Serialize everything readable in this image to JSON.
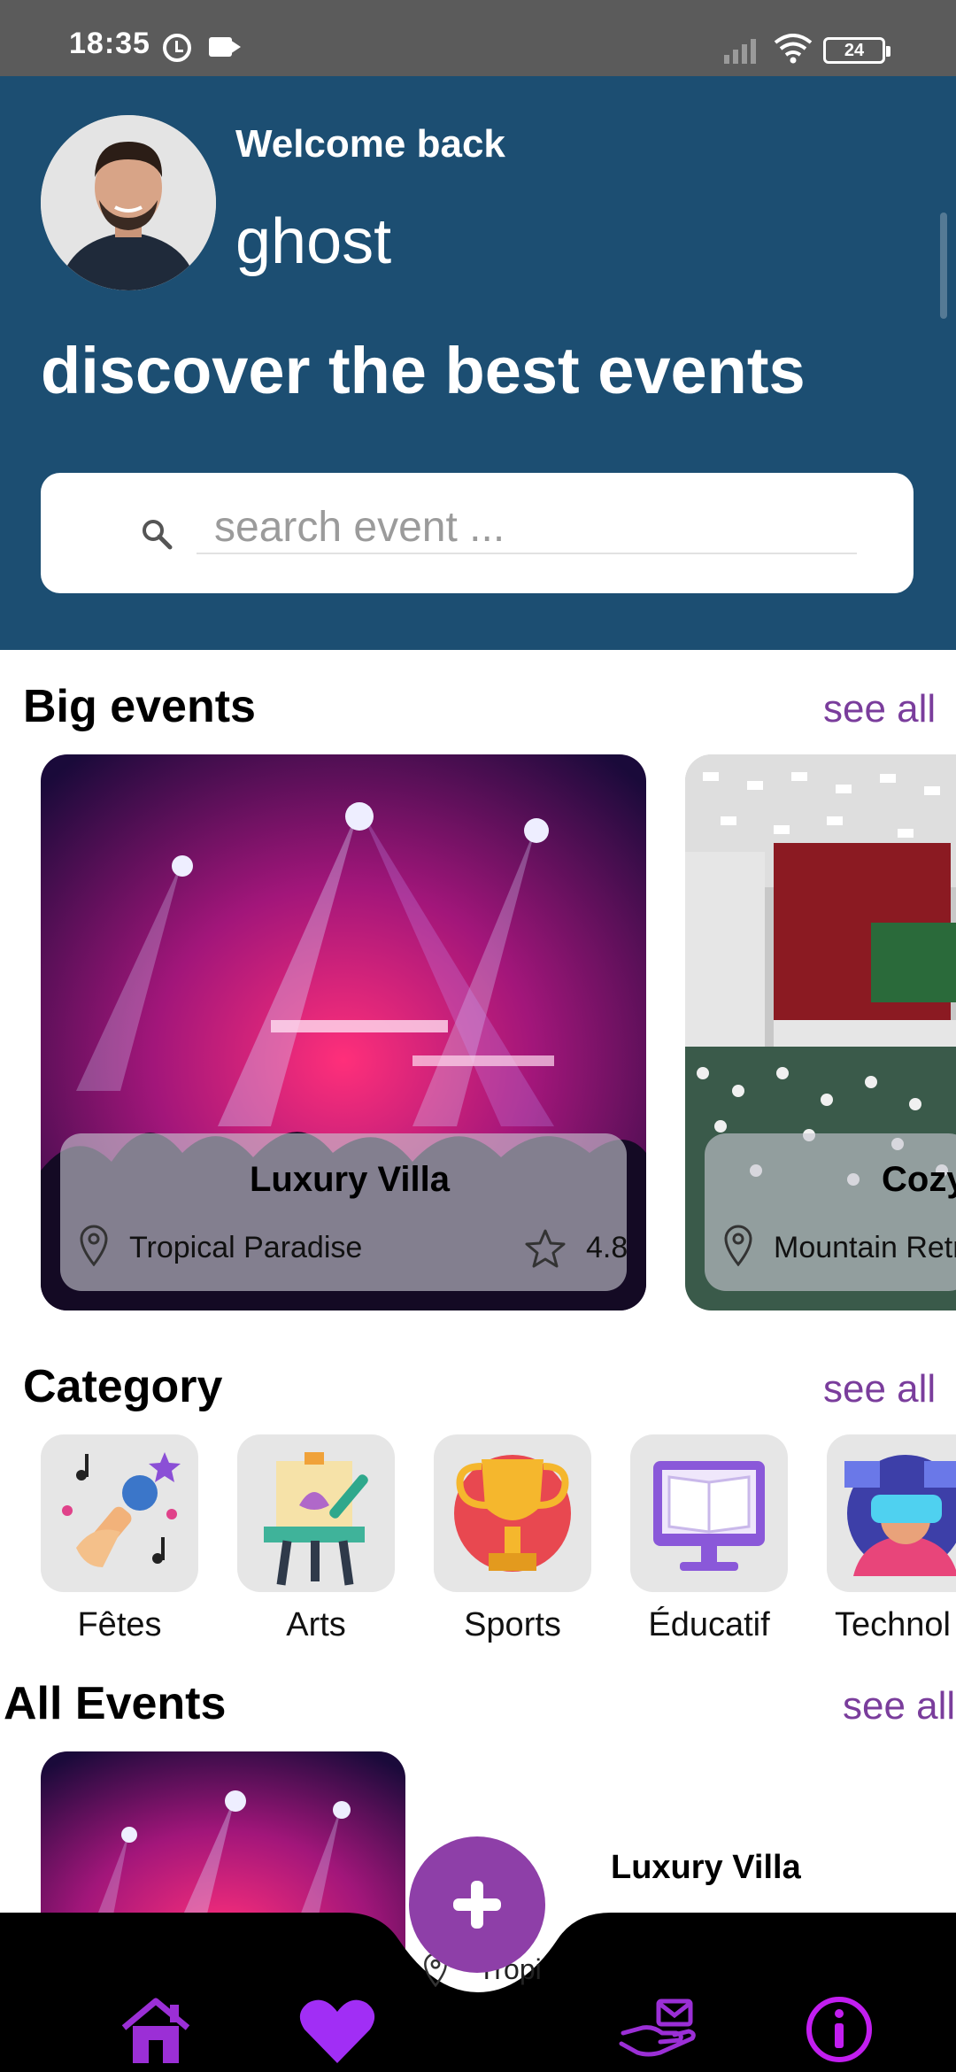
{
  "status_bar": {
    "time": "18:35",
    "battery": "24",
    "icons": [
      "alarm-icon",
      "video-icon",
      "signal-icon",
      "wifi-icon",
      "battery-icon"
    ]
  },
  "header": {
    "welcome": "Welcome back",
    "username": "ghost",
    "headline": "discover the best events",
    "avatar_icon": "user-avatar"
  },
  "search": {
    "placeholder": "search event ...",
    "value": ""
  },
  "big_events": {
    "title": "Big events",
    "see_all": "see all",
    "cards": [
      {
        "title": "Luxury Villa",
        "location": "Tropical Paradise",
        "rating": "4.8"
      },
      {
        "title": "Cozy",
        "location": "Mountain Retr"
      }
    ]
  },
  "category": {
    "title": "Category",
    "see_all": "see all",
    "items": [
      {
        "label": "Fêtes",
        "icon": "party-mic-icon"
      },
      {
        "label": "Arts",
        "icon": "easel-icon"
      },
      {
        "label": "Sports",
        "icon": "trophy-icon"
      },
      {
        "label": "Éducatif",
        "icon": "book-screen-icon"
      },
      {
        "label": "Technol",
        "icon": "vr-headset-icon"
      }
    ]
  },
  "all_events": {
    "title": "All Events",
    "see_all": "see all",
    "items": [
      {
        "title": "Luxury Villa",
        "location": "Tropi"
      }
    ]
  },
  "bottom_nav": {
    "items": [
      "home-icon",
      "heart-icon",
      "add-icon",
      "hand-mail-icon",
      "info-icon"
    ]
  },
  "colors": {
    "header_bg": "#1c4e72",
    "accent": "#7a3d9c",
    "nav_icon": "#9b2fd6",
    "nav_bg": "#000000"
  }
}
